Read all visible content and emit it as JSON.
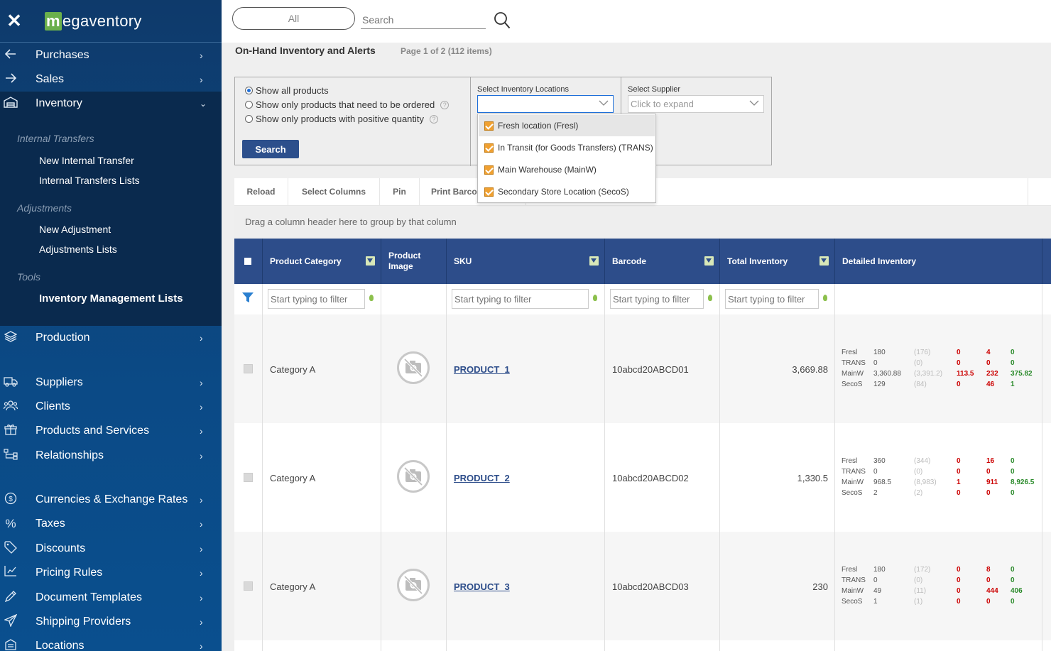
{
  "app": {
    "close": "✕",
    "logo_m": "m",
    "logo_rest": "egaventory"
  },
  "sidebar": {
    "items": [
      {
        "label": "Purchases",
        "icon": "arrow-left-icon"
      },
      {
        "label": "Sales",
        "icon": "arrow-right-icon"
      },
      {
        "label": "Inventory",
        "icon": "warehouse-icon"
      },
      {
        "label": "Production",
        "icon": "layers-icon"
      },
      {
        "label": "Suppliers",
        "icon": "truck-icon"
      },
      {
        "label": "Clients",
        "icon": "users-icon"
      },
      {
        "label": "Products and Services",
        "icon": "box-icon"
      },
      {
        "label": "Relationships",
        "icon": "sitemap-icon"
      },
      {
        "label": "Currencies & Exchange Rates",
        "icon": "dollar-icon"
      },
      {
        "label": "Taxes",
        "icon": "percent-icon"
      },
      {
        "label": "Discounts",
        "icon": "tag-icon"
      },
      {
        "label": "Pricing Rules",
        "icon": "pricing-icon"
      },
      {
        "label": "Document Templates",
        "icon": "pen-icon"
      },
      {
        "label": "Shipping Providers",
        "icon": "send-icon"
      },
      {
        "label": "Locations",
        "icon": "location-icon"
      }
    ],
    "inventory_sub": {
      "internal_transfers": "Internal Transfers",
      "new_internal_transfer": "New Internal Transfer",
      "internal_transfers_lists": "Internal Transfers Lists",
      "adjustments": "Adjustments",
      "new_adjustment": "New Adjustment",
      "adjustments_lists": "Adjustments Lists",
      "tools": "Tools",
      "inventory_management_lists": "Inventory Management Lists"
    }
  },
  "topbar": {
    "scope": "All",
    "search_placeholder": "Search"
  },
  "page": {
    "title": "On-Hand Inventory and Alerts",
    "page_info": "Page 1 of 2 (112 items)"
  },
  "filters": {
    "show_all": "Show all products",
    "show_need_order": "Show only products that need to be ordered",
    "show_positive": "Show only products with positive quantity",
    "search_button": "Search",
    "locations_label": "Select Inventory Locations",
    "supplier_label": "Select Supplier",
    "supplier_placeholder": "Click to expand",
    "locations_options": [
      "Fresh location (Fresl)",
      "In Transit (for Goods Transfers) (TRANS)",
      "Main Warehouse (MainW)",
      "Secondary Store Location (SecoS)"
    ]
  },
  "toolbar": {
    "reload": "Reload",
    "select_columns": "Select Columns",
    "pin": "Pin",
    "print_barcodes": "Print Barcodes"
  },
  "group_hint": "Drag a column header here to group by that column",
  "grid": {
    "columns": {
      "category": "Product Category",
      "image": "Product Image",
      "sku": "SKU",
      "barcode": "Barcode",
      "total": "Total Inventory",
      "detailed": "Detailed Inventory"
    },
    "filter_placeholder": "Start typing to filter",
    "rows": [
      {
        "category": "Category A",
        "sku": "PRODUCT_1",
        "barcode": "10abcd20ABCD01",
        "total": "3,669.88",
        "detail": {
          "locs": [
            "Fresl",
            "TRANS",
            "MainW",
            "SecoS"
          ],
          "qty": [
            "180",
            "0",
            "3,360.88",
            "129"
          ],
          "paren": [
            "(176)",
            "(0)",
            "(3,391.2)",
            "(84)"
          ],
          "c1": [
            "0",
            "0",
            "113.5",
            "0"
          ],
          "c2": [
            "4",
            "0",
            "232",
            "46"
          ],
          "c3": [
            "0",
            "0",
            "375.82",
            "1"
          ]
        }
      },
      {
        "category": "Category A",
        "sku": "PRODUCT_2",
        "barcode": "10abcd20ABCD02",
        "total": "1,330.5",
        "detail": {
          "locs": [
            "Fresl",
            "TRANS",
            "MainW",
            "SecoS"
          ],
          "qty": [
            "360",
            "0",
            "968.5",
            "2"
          ],
          "paren": [
            "(344)",
            "(0)",
            "(8,983)",
            "(2)"
          ],
          "c1": [
            "0",
            "0",
            "1",
            "0"
          ],
          "c2": [
            "16",
            "0",
            "911",
            "0"
          ],
          "c3": [
            "0",
            "0",
            "8,926.5",
            "0"
          ]
        }
      },
      {
        "category": "Category A",
        "sku": "PRODUCT_3",
        "barcode": "10abcd20ABCD03",
        "total": "230",
        "detail": {
          "locs": [
            "Fresl",
            "TRANS",
            "MainW",
            "SecoS"
          ],
          "qty": [
            "180",
            "0",
            "49",
            "1"
          ],
          "paren": [
            "(172)",
            "(0)",
            "(11)",
            "(1)"
          ],
          "c1": [
            "0",
            "0",
            "0",
            "0"
          ],
          "c2": [
            "8",
            "0",
            "444",
            "0"
          ],
          "c3": [
            "0",
            "0",
            "406",
            "0"
          ]
        }
      }
    ]
  },
  "colors": {
    "sidebar": "#0b4a86",
    "header": "#2d4d8a",
    "accent_orange": "#f0a030",
    "red": "#cc0000",
    "green": "#2a8a2a"
  }
}
